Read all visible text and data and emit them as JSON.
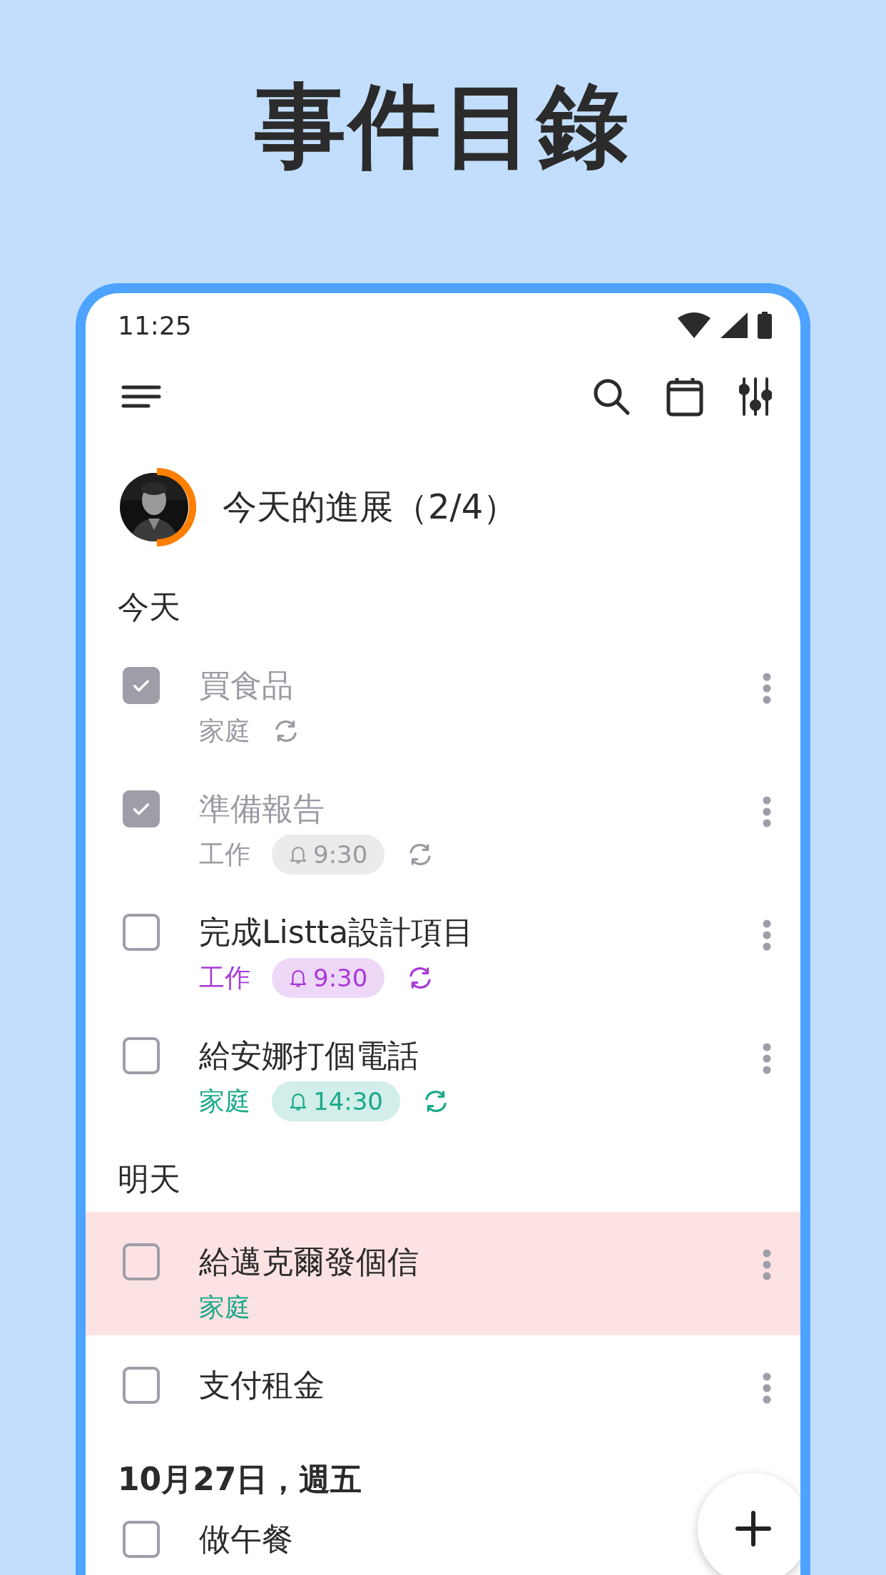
{
  "headline": "事件目錄",
  "status_bar": {
    "time": "11:25"
  },
  "progress": {
    "title": "今天的進展（2/4）",
    "level": 0.5
  },
  "sections": [
    {
      "heading": "今天",
      "tasks": [
        {
          "title": "買食品",
          "checked": true,
          "highlighted": false,
          "tag": "家庭",
          "color": "#9a9aa2",
          "repeat": true
        },
        {
          "title": "準備報告",
          "checked": true,
          "highlighted": false,
          "tag": "工作",
          "color": "#9a9aa2",
          "reminder": "9:30",
          "repeat": true
        },
        {
          "title": "完成Listta設計項目",
          "checked": false,
          "highlighted": false,
          "tag": "工作",
          "color": "#a83ad8",
          "reminder": "9:30",
          "repeat": true
        },
        {
          "title": "給安娜打個電話",
          "checked": false,
          "highlighted": false,
          "tag": "家庭",
          "color": "#1ba98a",
          "reminder": "14:30",
          "repeat": true
        }
      ]
    },
    {
      "heading": "明天",
      "tasks": [
        {
          "title": "給邁克爾發個信",
          "checked": false,
          "highlighted": true,
          "tag": "家庭",
          "color": "#1ba98a",
          "repeat": false
        },
        {
          "title": "支付租金",
          "checked": false,
          "highlighted": false,
          "repeat": false
        }
      ]
    },
    {
      "heading": "10月27日，週五",
      "tasks": [
        {
          "title": "做午餐",
          "checked": false,
          "highlighted": false,
          "repeat": false
        }
      ]
    }
  ]
}
